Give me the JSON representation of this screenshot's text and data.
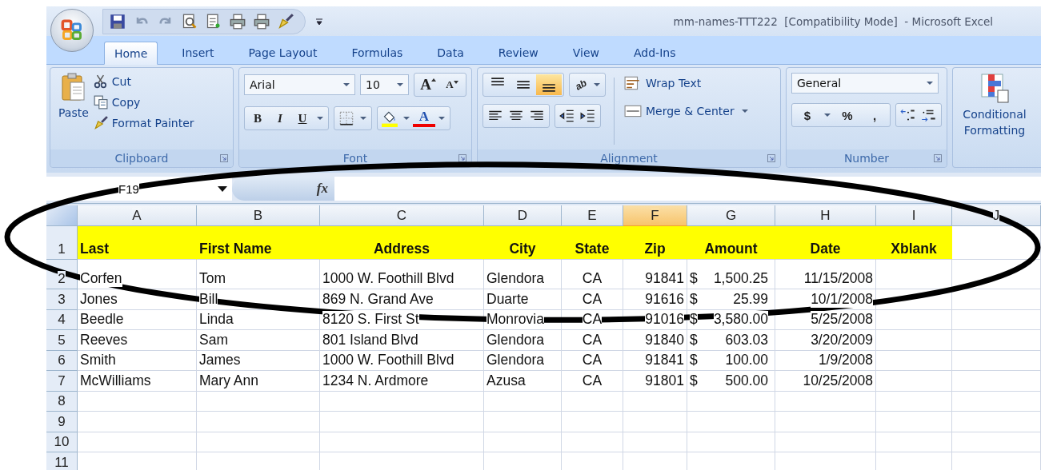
{
  "window": {
    "title": "mm-names-TTT222  [Compatibility Mode]  - Microsoft Excel"
  },
  "tabs": [
    {
      "label": "Home",
      "selected": true
    },
    {
      "label": "Insert",
      "selected": false
    },
    {
      "label": "Page Layout",
      "selected": false
    },
    {
      "label": "Formulas",
      "selected": false
    },
    {
      "label": "Data",
      "selected": false
    },
    {
      "label": "Review",
      "selected": false
    },
    {
      "label": "View",
      "selected": false
    },
    {
      "label": "Add-Ins",
      "selected": false
    }
  ],
  "clipboard": {
    "paste": "Paste",
    "cut": "Cut",
    "copy": "Copy",
    "format_painter": "Format Painter",
    "label": "Clipboard"
  },
  "font": {
    "name": "Arial",
    "size": "10",
    "label": "Font",
    "bold": "B",
    "italic": "I",
    "underline": "U",
    "grow": "A",
    "shrink": "A",
    "color_letter": "A"
  },
  "alignment": {
    "vertical": [
      {
        "selected": false
      },
      {
        "selected": false
      },
      {
        "selected": true
      }
    ],
    "orientation": "ab",
    "wrap_text": "Wrap Text",
    "merge": "Merge & Center",
    "label": "Alignment"
  },
  "number": {
    "format": "General",
    "currency": "$",
    "percent": "%",
    "comma": ",",
    "label": "Number"
  },
  "styles": {
    "conditional_formatting": "Conditional Formatting"
  },
  "formula_bar": {
    "name_box": "F19",
    "fx": "fx"
  },
  "sheet": {
    "columns": [
      {
        "label": "A",
        "selected": false
      },
      {
        "label": "B",
        "selected": false
      },
      {
        "label": "C",
        "selected": false
      },
      {
        "label": "D",
        "selected": false
      },
      {
        "label": "E",
        "selected": false
      },
      {
        "label": "F",
        "selected": true
      },
      {
        "label": "G",
        "selected": false
      },
      {
        "label": "H",
        "selected": false
      },
      {
        "label": "I",
        "selected": false
      },
      {
        "label": "J",
        "selected": false
      }
    ],
    "header_row": {
      "number": "1",
      "cells": [
        "Last",
        "First Name",
        "Address",
        "City",
        "State",
        "Zip",
        "Amount",
        "Date",
        "Xblank"
      ]
    },
    "rows": [
      {
        "number": "2",
        "last": "Corfen",
        "first": "Tom",
        "address": "1000 W. Foothill Blvd",
        "city": "Glendora",
        "state": "CA",
        "zip": "91841",
        "currency": "$",
        "amount": "1,500.25",
        "date": "11/15/2008"
      },
      {
        "number": "3",
        "last": "Jones",
        "first": "Bill",
        "address": "869 N. Grand Ave",
        "city": "Duarte",
        "state": "CA",
        "zip": "91616",
        "currency": "$",
        "amount": "25.99",
        "date": "10/1/2008"
      },
      {
        "number": "4",
        "last": "Beedle",
        "first": "Linda",
        "address": "8120 S. First St",
        "city": "Monrovia",
        "state": "CA",
        "zip": "91016",
        "currency": "$",
        "amount": "3,580.00",
        "date": "5/25/2008"
      },
      {
        "number": "5",
        "last": "Reeves",
        "first": "Sam",
        "address": "801 Island Blvd",
        "city": "Glendora",
        "state": "CA",
        "zip": "91840",
        "currency": "$",
        "amount": "603.03",
        "date": "3/20/2009"
      },
      {
        "number": "6",
        "last": "Smith",
        "first": "James",
        "address": "1000 W. Foothill Blvd",
        "city": "Glendora",
        "state": "CA",
        "zip": "91841",
        "currency": "$",
        "amount": "100.00",
        "date": "1/9/2008"
      },
      {
        "number": "7",
        "last": "McWilliams",
        "first": "Mary Ann",
        "address": "1234 N. Ardmore",
        "city": "Azusa",
        "state": "CA",
        "zip": "91801",
        "currency": "$",
        "amount": "500.00",
        "date": "10/25/2008"
      }
    ],
    "empty_rows": [
      "8",
      "9",
      "10",
      "11"
    ]
  }
}
